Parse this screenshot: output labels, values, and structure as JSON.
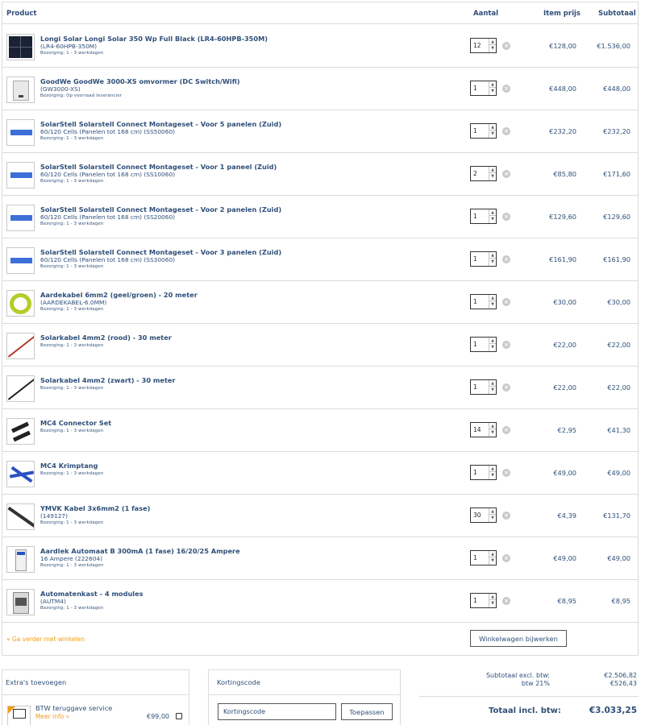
{
  "header": {
    "product": "Product",
    "aantal": "Aantal",
    "item_prijs": "Item prijs",
    "subtotaal": "Subtotaal"
  },
  "items": [
    {
      "name": "Longi Solar Longi Solar 350 Wp Full Black (LR4-60HPB-350M)",
      "sku": "(LR4-60HPB-350M)",
      "delivery": "Bezorging: 1 - 3 werkdagen",
      "qty": "12",
      "price": "€128,00",
      "subtotal": "€1.536,00",
      "icon": "solar-panel-icon"
    },
    {
      "name": "GoodWe GoodWe 3000-XS omvormer (DC Switch/Wifi)",
      "sku": "(GW3000-XS)",
      "delivery": "Bezorging: Op voorraad leverancier",
      "qty": "1",
      "price": "€448,00",
      "subtotal": "€448,00",
      "icon": "inverter-icon"
    },
    {
      "name": "SolarStell Solarstell Connect Montageset - Voor 5 panelen (Zuid)",
      "sku": "60/120 Cells (Panelen tot 168 cm) (SS50060)",
      "delivery": "Bezorging: 1 - 3 werkdagen",
      "qty": "1",
      "price": "€232,20",
      "subtotal": "€232,20",
      "icon": "mounting-set-icon"
    },
    {
      "name": "SolarStell Solarstell Connect Montageset - Voor 1 paneel (Zuid)",
      "sku": "60/120 Cells (Panelen tot 168 cm) (SS10060)",
      "delivery": "Bezorging: 1 - 3 werkdagen",
      "qty": "2",
      "price": "€85,80",
      "subtotal": "€171,60",
      "icon": "mounting-set-icon"
    },
    {
      "name": "SolarStell Solarstell Connect Montageset - Voor 2 panelen (Zuid)",
      "sku": "60/120 Cells (Panelen tot 168 cm) (SS20060)",
      "delivery": "Bezorging: 1 - 3 werkdagen",
      "qty": "1",
      "price": "€129,60",
      "subtotal": "€129,60",
      "icon": "mounting-set-icon"
    },
    {
      "name": "SolarStell Solarstell Connect Montageset - Voor 3 panelen (Zuid)",
      "sku": "60/120 Cells (Panelen tot 168 cm) (SS30060)",
      "delivery": "Bezorging: 1 - 3 werkdagen",
      "qty": "1",
      "price": "€161,90",
      "subtotal": "€161,90",
      "icon": "mounting-set-icon"
    },
    {
      "name": "Aardekabel 6mm2 (geel/groen) - 20 meter",
      "sku": "(AARDEKABEL-6.0MM)",
      "delivery": "Bezorging: 1 - 3 werkdagen",
      "qty": "1",
      "price": "€30,00",
      "subtotal": "€30,00",
      "icon": "cable-coil-icon"
    },
    {
      "name": "Solarkabel 4mm2 (rood) - 30 meter",
      "sku": "",
      "delivery": "Bezorging: 1 - 3 werkdagen",
      "qty": "1",
      "price": "€22,00",
      "subtotal": "€22,00",
      "icon": "red-cable-icon"
    },
    {
      "name": "Solarkabel 4mm2 (zwart) - 30 meter",
      "sku": "",
      "delivery": "Bezorging: 1 - 3 werkdagen",
      "qty": "1",
      "price": "€22,00",
      "subtotal": "€22,00",
      "icon": "black-cable-icon"
    },
    {
      "name": "MC4 Connector Set",
      "sku": "",
      "delivery": "Bezorging: 1 - 3 werkdagen",
      "qty": "14",
      "price": "€2,95",
      "subtotal": "€41,30",
      "icon": "connector-icon"
    },
    {
      "name": "MC4 Krimptang",
      "sku": "",
      "delivery": "Bezorging: 1 - 3 werkdagen",
      "qty": "1",
      "price": "€49,00",
      "subtotal": "€49,00",
      "icon": "crimp-tool-icon"
    },
    {
      "name": "YMVK Kabel 3x6mm2 (1 fase)",
      "sku": "(149127)",
      "delivery": "Bezorging: 1 - 3 werkdagen",
      "qty": "30",
      "price": "€4,39",
      "subtotal": "€131,70",
      "icon": "ymvk-cable-icon"
    },
    {
      "name": "Aardlek Automaat B 300mA (1 fase) 16/20/25 Ampere",
      "sku": "16 Ampere (222604)",
      "delivery": "Bezorging: 1 - 3 werkdagen",
      "qty": "1",
      "price": "€49,00",
      "subtotal": "€49,00",
      "icon": "breaker-icon"
    },
    {
      "name": "Automatenkast - 4 modules",
      "sku": "(AUTM4)",
      "delivery": "Bezorging: 1 - 3 werkdagen",
      "qty": "1",
      "price": "€8,95",
      "subtotal": "€8,95",
      "icon": "cabinet-icon"
    }
  ],
  "footer": {
    "continue": "« Ga verder met winkelen",
    "update": "Winkelwagen bijwerken"
  },
  "extras": {
    "title": "Extra's toevoegen",
    "btw_name": "BTW teruggave service",
    "btw_more": "Meer info »",
    "btw_price": "€99,00"
  },
  "coupon": {
    "title": "Kortingscode",
    "placeholder": "Kortingscode",
    "apply": "Toepassen"
  },
  "totals": {
    "excl_label": "Subtotaal excl. btw:",
    "excl_value": "€2.506,82",
    "btw_label": "btw 21%",
    "btw_value": "€526,43",
    "grand_label": "Totaal incl. btw:",
    "grand_value": "€3.033,25"
  },
  "colors": {
    "text": "#2f4f79",
    "link": "#f39c12",
    "border": "#dcdcdc"
  }
}
